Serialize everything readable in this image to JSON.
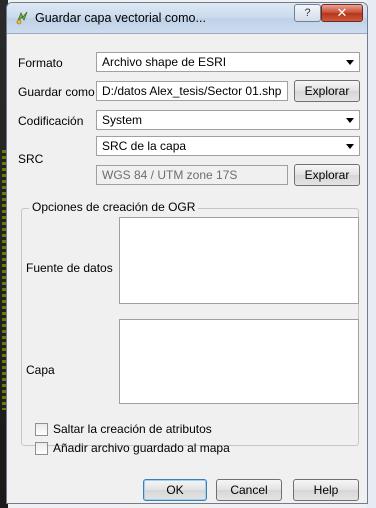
{
  "window": {
    "title": "Guardar capa vectorial como...",
    "help_label": "?",
    "close_label": "✕"
  },
  "form": {
    "formato_label": "Formato",
    "formato_value": "Archivo shape de ESRI",
    "guardar_label": "Guardar como",
    "guardar_value": "D:/datos Alex_tesis/Sector 01.shp",
    "explorar_label": "Explorar",
    "codificacion_label": "Codificación",
    "codificacion_value": "System",
    "src_label": "SRC",
    "src_mode_value": "SRC de la capa",
    "src_crs_value": "WGS 84 / UTM zone 17S",
    "explorar_src_label": "Explorar"
  },
  "ogr": {
    "group_title": "Opciones de creación de OGR",
    "fuente_label": "Fuente de datos",
    "capa_label": "Capa"
  },
  "options": {
    "saltar_label": "Saltar la creación de atributos",
    "anadir_label": "Añadir archivo guardado al mapa"
  },
  "buttons": {
    "ok": "OK",
    "cancel": "Cancel",
    "help": "Help"
  }
}
